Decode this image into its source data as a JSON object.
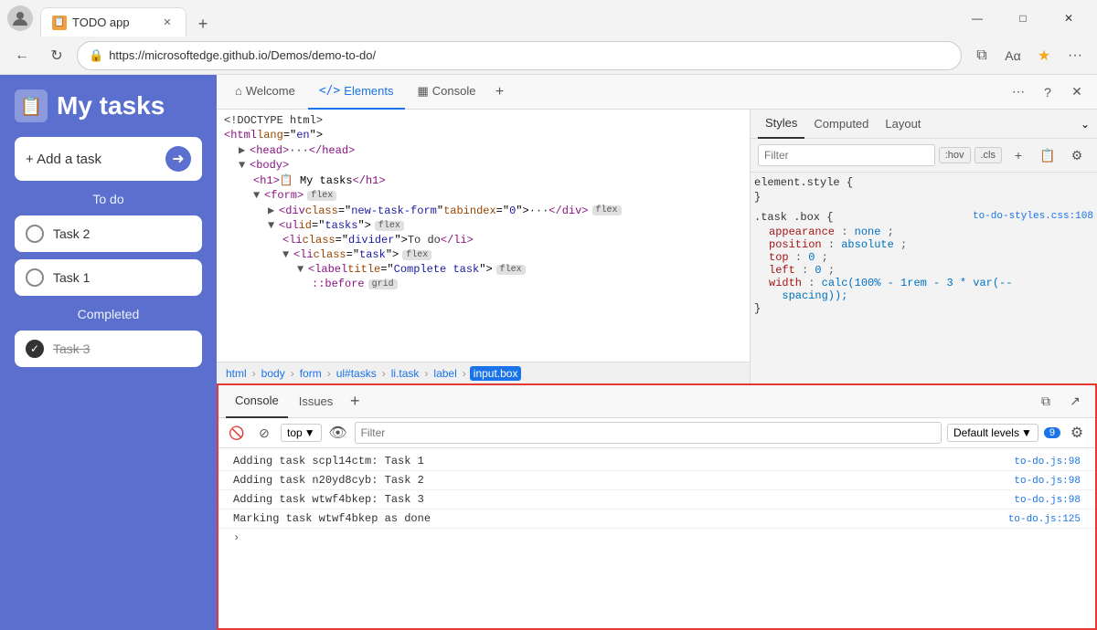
{
  "browser": {
    "tab_title": "TODO app",
    "url": "https://microsoftedge.github.io/Demos/demo-to-do/",
    "profile_icon": "👤"
  },
  "app": {
    "title": "My tasks",
    "icon": "📋",
    "add_task_label": "+ Add a task",
    "section_todo": "To do",
    "tasks": [
      {
        "id": 1,
        "text": "Task 2",
        "checked": false
      },
      {
        "id": 2,
        "text": "Task 1",
        "checked": false
      }
    ],
    "section_completed": "Completed",
    "completed_tasks": [
      {
        "id": 3,
        "text": "Task 3",
        "checked": true
      }
    ]
  },
  "devtools": {
    "tabs": [
      {
        "label": "Welcome",
        "icon": "⌂",
        "active": false
      },
      {
        "label": "Elements",
        "icon": "</>",
        "active": true
      },
      {
        "label": "Console",
        "icon": "▦",
        "active": false
      }
    ],
    "elements": {
      "lines": [
        {
          "indent": 0,
          "html": "<!DOCTYPE html>"
        },
        {
          "indent": 0,
          "html": "<html lang=\"en\">"
        },
        {
          "indent": 1,
          "html": "▶ <head> ··· </head>"
        },
        {
          "indent": 1,
          "html": "▼ <body>"
        },
        {
          "indent": 2,
          "html": "<h1> 📋 My tasks</h1>"
        },
        {
          "indent": 2,
          "html": "▼ <form>"
        },
        {
          "indent": 3,
          "html": "<div class=\"new-task-form\" tabindex=\"0\"> ··· </div>"
        },
        {
          "indent": 3,
          "html": "▼ <ul id=\"tasks\">"
        },
        {
          "indent": 4,
          "html": "<li class=\"divider\">To do</li>"
        },
        {
          "indent": 4,
          "html": "▼ <li class=\"task\">"
        },
        {
          "indent": 5,
          "html": "▼ <label title=\"Complete task\">"
        },
        {
          "indent": 6,
          "html": "::before"
        }
      ],
      "breadcrumbs": [
        "html",
        "body",
        "form",
        "ul#tasks",
        "li.task",
        "label",
        "input.box"
      ]
    },
    "styles": {
      "tabs": [
        "Styles",
        "Computed",
        "Layout"
      ],
      "active_tab": "Styles",
      "filter_placeholder": "Filter",
      "pseudo_buttons": [
        ":hov",
        ".cls"
      ],
      "rules": [
        {
          "selector": "element.style {",
          "close": "}",
          "props": []
        },
        {
          "selector": ".task .box {",
          "source": "to-do-styles.css:108",
          "close": "}",
          "props": [
            "appearance: none;",
            "position: absolute;",
            "top: 0;",
            "left: 0;",
            "width: calc(100% - 1rem - 3 * var(--",
            "  spacing));"
          ]
        }
      ]
    },
    "console": {
      "tabs": [
        "Console",
        "Issues"
      ],
      "toolbar": {
        "context": "top",
        "filter_placeholder": "Filter",
        "level": "Default levels",
        "error_count": "9"
      },
      "lines": [
        {
          "text": "Adding task scpl14ctm: Task 1",
          "source": "to-do.js:98"
        },
        {
          "text": "Adding task n20yd8cyb: Task 2",
          "source": "to-do.js:98"
        },
        {
          "text": "Adding task wtwf4bkep: Task 3",
          "source": "to-do.js:98"
        },
        {
          "text": "Marking task wtwf4bkep as done",
          "source": "to-do.js:125"
        }
      ]
    }
  },
  "window_controls": {
    "minimize": "—",
    "maximize": "□",
    "close": "✕"
  }
}
